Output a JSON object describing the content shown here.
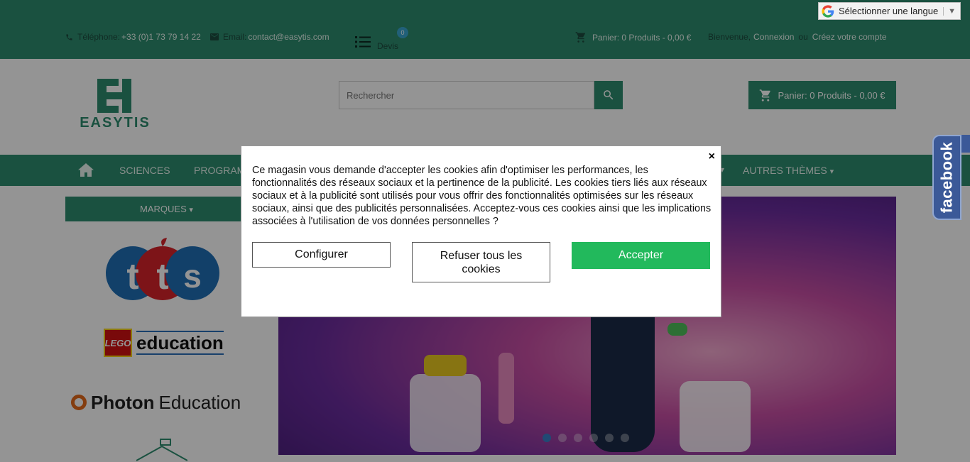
{
  "topbar": {
    "phone_label": "Téléphone:",
    "phone_value": "+33 (0)1 73 79 14 22",
    "email_label": "Email:",
    "email_value": "contact@easytis.com",
    "devis_label": "Devis",
    "devis_count": "0",
    "cart_text": "Panier: 0 Produits - 0,00 €",
    "welcome": "Bienvenue,",
    "login": "Connexion",
    "or": "ou",
    "create_account": "Créez votre compte"
  },
  "language": {
    "label": "Sélectionner une langue"
  },
  "header": {
    "logo_text": "EASYTIS",
    "search_placeholder": "Rechercher",
    "cart_button": "Panier: 0 Produits - 0,00 €"
  },
  "nav": {
    "items": [
      "SCIENCES",
      "PROGRAM",
      "AUTRES THÈMES"
    ]
  },
  "brands": {
    "header": "MARQUES",
    "lego_badge": "LEGO",
    "lego_text": "education",
    "photon_text": "Photon",
    "photon_sub": "Education",
    "tts_text": "tts"
  },
  "banner": {
    "slide_count": 6,
    "active_slide": 1
  },
  "facebook": {
    "label": "facebook"
  },
  "cookie_modal": {
    "close": "×",
    "text": "Ce magasin vous demande d'accepter les cookies afin d'optimiser les performances, les fonctionnalités des réseaux sociaux et la pertinence de la publicité. Les cookies tiers liés aux réseaux sociaux et à la publicité sont utilisés pour vous offrir des fonctionnalités optimisées sur les réseaux sociaux, ainsi que des publicités personnalisées. Acceptez-vous ces cookies ainsi que les implications associées à l'utilisation de vos données personnelles ?",
    "configure": "Configurer",
    "refuse": "Refuser tous les cookies",
    "accept": "Accepter"
  },
  "colors": {
    "brand": "#2d8c6e",
    "accept": "#22b95c",
    "facebook": "#3b5998"
  }
}
